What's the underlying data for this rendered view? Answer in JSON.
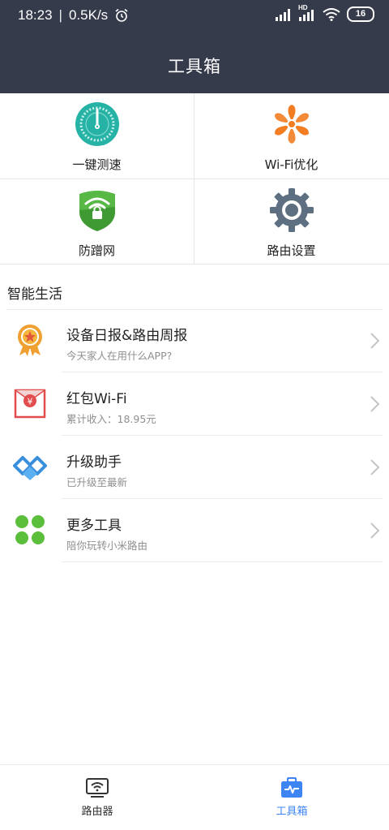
{
  "status_bar": {
    "time": "18:23",
    "speed": "0.5K/s",
    "battery": "16",
    "hd_label": "HD"
  },
  "header": {
    "title": "工具箱"
  },
  "tools": [
    {
      "label": "一键测速",
      "icon": "speedometer-icon"
    },
    {
      "label": "Wi-Fi优化",
      "icon": "fan-icon"
    },
    {
      "label": "防蹭网",
      "icon": "wifi-shield-icon"
    },
    {
      "label": "路由设置",
      "icon": "gear-icon"
    }
  ],
  "section": {
    "title": "智能生活"
  },
  "list": [
    {
      "title": "设备日报&路由周报",
      "subtitle": "今天家人在用什么APP?",
      "icon": "award-badge-icon"
    },
    {
      "title": "红包Wi-Fi",
      "subtitle": "累计收入：18.95元",
      "icon": "red-envelope-icon"
    },
    {
      "title": "升级助手",
      "subtitle": "已升级至最新",
      "icon": "upgrade-icon"
    },
    {
      "title": "更多工具",
      "subtitle": "陪你玩转小米路由",
      "icon": "four-dots-icon"
    }
  ],
  "red_envelope_glyph": "¥",
  "tabbar": {
    "tabs": [
      {
        "label": "路由器",
        "icon": "router-icon",
        "active": false
      },
      {
        "label": "工具箱",
        "icon": "toolbox-icon",
        "active": true
      }
    ]
  },
  "colors": {
    "header_bg": "#363b4c",
    "accent": "#3d84f5",
    "speed_teal": "#26b3a5",
    "fan_orange": "#f27d22",
    "shield_green": "#57b846",
    "gear_gray": "#5d6f80",
    "red": "#e24c4c"
  }
}
